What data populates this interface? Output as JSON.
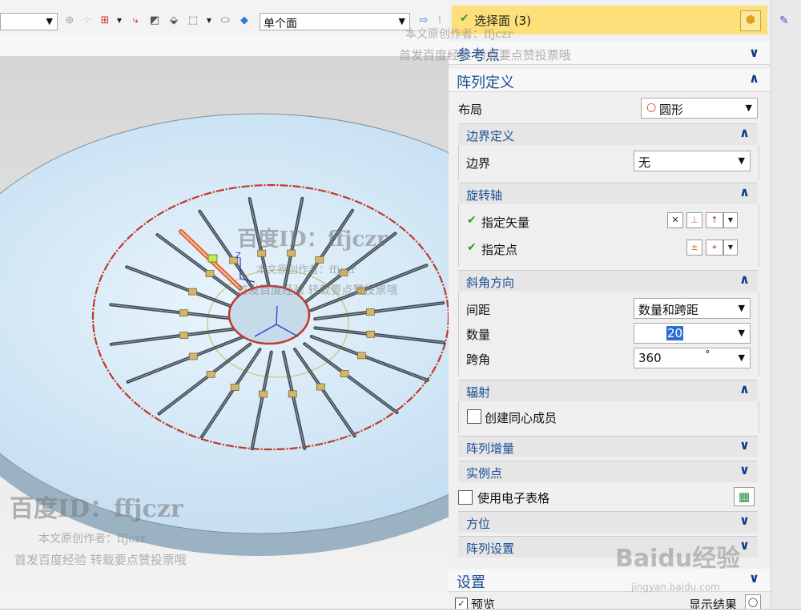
{
  "toolbar": {
    "filter_value": "",
    "face_rule": "单个面"
  },
  "panel": {
    "select_face": "选择面 (3)",
    "reference_point": "参考点",
    "array_def": "阵列定义",
    "layout_label": "布局",
    "layout_value": "圆形",
    "boundary_def": "边界定义",
    "boundary_label": "边界",
    "boundary_value": "无",
    "rotation_axis": "旋转轴",
    "specify_vector": "指定矢量",
    "specify_point": "指定点",
    "angle_direction": "斜角方向",
    "spacing_label": "间距",
    "spacing_value": "数量和跨距",
    "count_label": "数量",
    "count_value": "20",
    "span_label": "跨角",
    "span_value": "360",
    "span_unit": "°",
    "radiate": "辐射",
    "create_concentric": "创建同心成员",
    "array_increment": "阵列增量",
    "instance_points": "实例点",
    "use_spreadsheet": "使用电子表格",
    "orientation": "方位",
    "array_settings": "阵列设置",
    "settings": "设置",
    "preview": "预览",
    "show_result": "显示结果"
  },
  "watermarks": {
    "id_text": "百度ID：ffjczr",
    "author": "本文原创作者：ffjczr",
    "notice": "首发百度经验 转载要点赞投票哦",
    "logo": "Baidu经验",
    "url": "jingyan.baidu.com"
  }
}
